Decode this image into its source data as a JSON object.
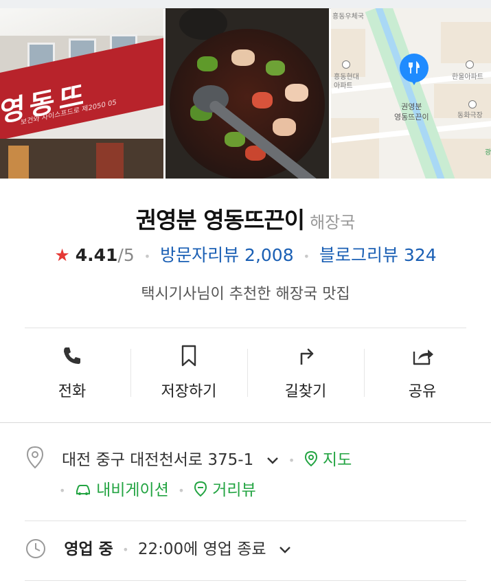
{
  "place": {
    "name": "권영분 영동뜨끈이",
    "category": "해장국",
    "rating_star": "★",
    "rating_value": "4.41",
    "rating_scale": "/5",
    "visitor_reviews": "방문자리뷰 2,008",
    "blog_reviews": "블로그리뷰 324",
    "tagline": "택시기사님이 추천한 해장국 맛집"
  },
  "photos": {
    "store_sign": "영동뜨",
    "store_sign_sub": "보건와 사이스프드로 제2050  05",
    "map_labels": {
      "post_office": "흥동우체국",
      "apt1_line1": "흥동현대",
      "apt1_line2": "아파트",
      "apt2": "한울아파트",
      "theater": "동화극장",
      "pin_line1": "권영분",
      "pin_line2": "영동뜨끈이",
      "edge": "광"
    }
  },
  "actions": [
    {
      "label": "전화",
      "icon": "phone-icon"
    },
    {
      "label": "저장하기",
      "icon": "bookmark-icon"
    },
    {
      "label": "길찾기",
      "icon": "directions-icon"
    },
    {
      "label": "공유",
      "icon": "share-icon"
    }
  ],
  "address": {
    "text": "대전 중구 대전천서로 375-1",
    "map_link": "지도",
    "navigation_link": "내비게이션",
    "street_view_link": "거리뷰"
  },
  "hours": {
    "status": "영업 중",
    "detail": "22:00에 영업 종료"
  },
  "colors": {
    "accent_green": "#23a442",
    "link_blue": "#1a5fb4",
    "star_red": "#e53935"
  }
}
